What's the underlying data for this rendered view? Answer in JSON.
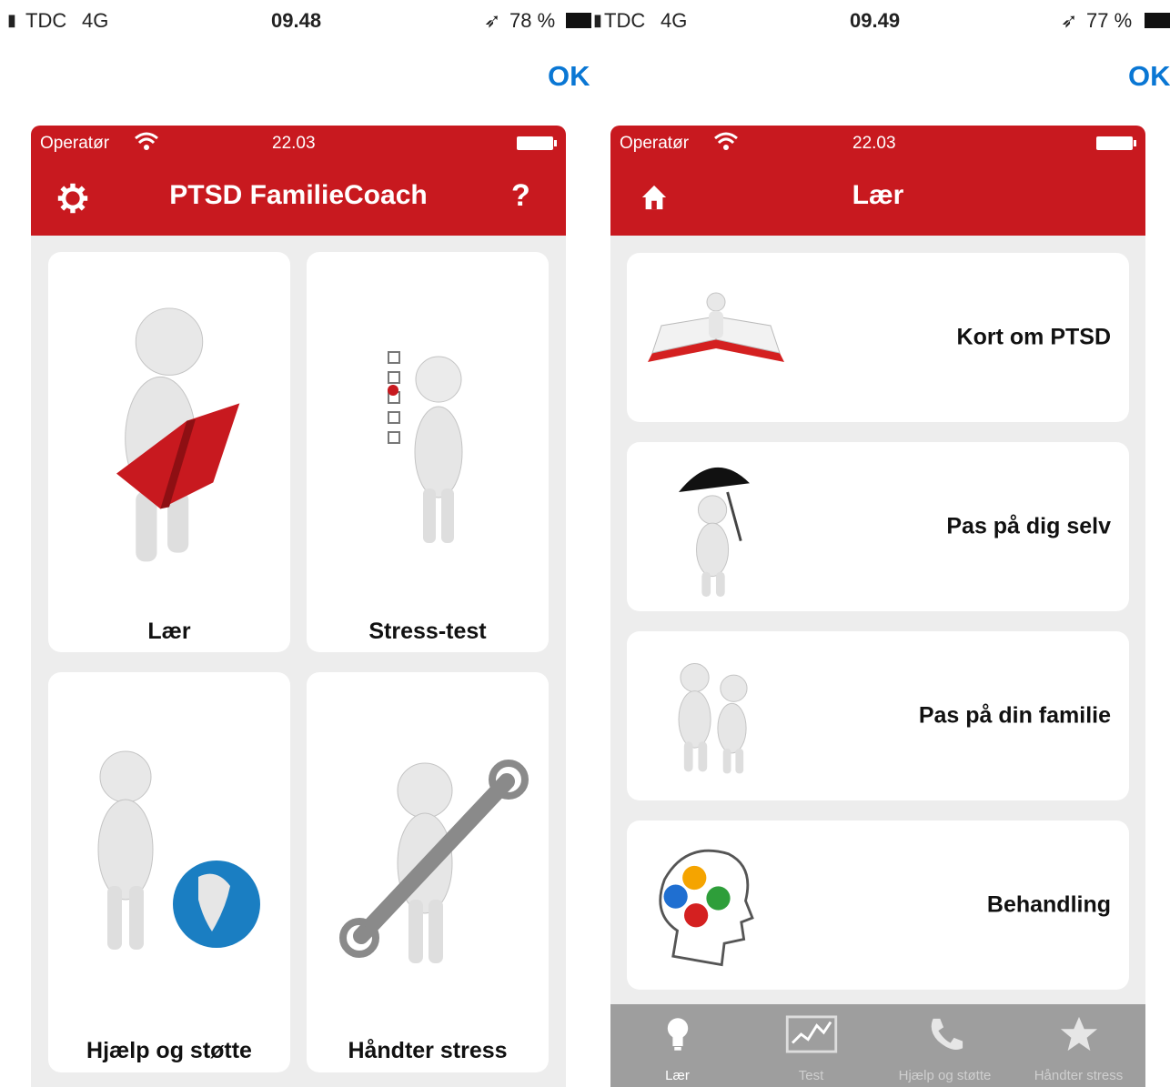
{
  "left_screen": {
    "device_status": {
      "carrier": "TDC",
      "network": "4G",
      "time": "09.48",
      "battery": "78 %"
    },
    "ok_label": "OK",
    "app_status": {
      "carrier": "Operatør",
      "time": "22.03"
    },
    "header": {
      "title": "PTSD FamilieCoach",
      "help_label": "?"
    },
    "tiles": [
      {
        "label": "Lær",
        "icon": "figure-reading-book"
      },
      {
        "label": "Stress-test",
        "icon": "figure-checklist"
      },
      {
        "label": "Hjælp og støtte",
        "icon": "figure-globe"
      },
      {
        "label": "Håndter stress",
        "icon": "figure-wrench"
      }
    ]
  },
  "right_screen": {
    "device_status": {
      "carrier": "TDC",
      "network": "4G",
      "time": "09.49",
      "battery": "77 %"
    },
    "ok_label": "OK",
    "app_status": {
      "carrier": "Operatør",
      "time": "22.03"
    },
    "header": {
      "title": "Lær"
    },
    "items": [
      {
        "label": "Kort om PTSD",
        "icon": "figure-open-book"
      },
      {
        "label": "Pas på dig selv",
        "icon": "figure-umbrella"
      },
      {
        "label": "Pas på din familie",
        "icon": "figures-comforting"
      },
      {
        "label": "Behandling",
        "icon": "head-gears"
      }
    ],
    "tabbar": [
      {
        "label": "Lær",
        "icon": "lightbulb-icon",
        "active": true
      },
      {
        "label": "Test",
        "icon": "chart-icon",
        "active": false
      },
      {
        "label": "Hjælp og støtte",
        "icon": "phone-icon",
        "active": false
      },
      {
        "label": "Håndter stress",
        "icon": "star-icon",
        "active": false
      }
    ]
  },
  "colors": {
    "header_red": "#c8191f",
    "ok_blue": "#0a77d4",
    "background": "#ededed",
    "tabbar_gray": "#9e9e9e"
  }
}
